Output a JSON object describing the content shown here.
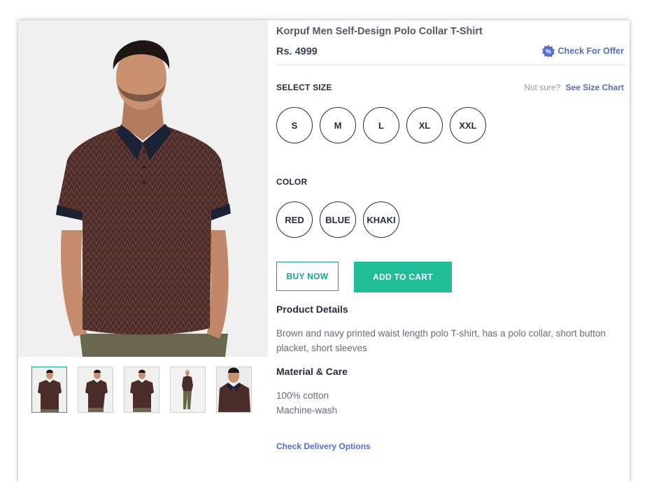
{
  "product": {
    "title": "Korpuf Men Self-Design Polo Collar T-Shirt",
    "price": "Rs. 4999",
    "offer_label": "Check For Offer",
    "offer_icon": "discount-badge-icon"
  },
  "size": {
    "label": "SELECT SIZE",
    "help_text": "Not sure?",
    "size_chart_link": "See Size Chart",
    "options": [
      "S",
      "M",
      "L",
      "XL",
      "XXL"
    ]
  },
  "color": {
    "label": "COLOR",
    "options": [
      "RED",
      "BLUE",
      "KHAKI"
    ]
  },
  "actions": {
    "buy_now": "BUY NOW",
    "add_to_cart": "ADD TO CART"
  },
  "product_details": {
    "heading": "Product Details",
    "text": "Brown and navy printed waist length polo T-shirt, has a polo collar, short button placket, short sleeves"
  },
  "material_care": {
    "heading": "Material & Care",
    "lines": [
      "100% cotton",
      "Machine-wash"
    ]
  },
  "delivery_link": "Check Delivery Options",
  "colors": {
    "accent_green": "#20bd99",
    "link_blue": "#526cd0",
    "shirt_brown": "#4b2e2a",
    "collar_navy": "#1c2236"
  },
  "thumbnails": {
    "count": 5,
    "selected_index": 0
  }
}
